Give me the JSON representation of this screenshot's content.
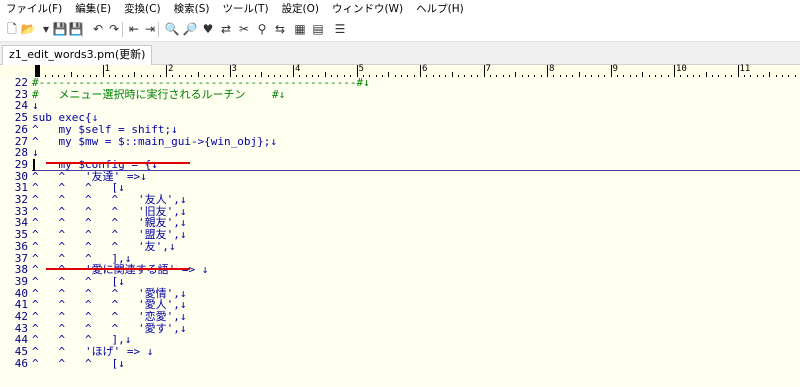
{
  "menu": [
    "ファイル(F)",
    "編集(E)",
    "変換(C)",
    "検索(S)",
    "ツール(T)",
    "設定(O)",
    "ウィンドウ(W)",
    "ヘルプ(H)"
  ],
  "toolbar_icons": [
    "new-file-icon",
    "open-file-icon",
    "open-dropdown-icon",
    "save-icon",
    "save-all-icon",
    "undo-icon",
    "redo-icon",
    "back-icon",
    "forward-icon",
    "find-icon",
    "find-next-icon",
    "find-prev-icon",
    "replace-icon",
    "grep-icon",
    "jump-icon",
    "compare-icon",
    "window-icon",
    "outline-icon",
    "settings-icon"
  ],
  "tab": {
    "label": "z1_edit_words3.pm(更新)"
  },
  "ruler": [
    "1",
    "2",
    "3",
    "4",
    "5",
    "6",
    "7",
    "8",
    "9",
    "10",
    "11"
  ],
  "lines": [
    {
      "num": "22",
      "text": "#------------------------------------------------#↓",
      "cls": "comment"
    },
    {
      "num": "23",
      "text": "#   メニュー選択時に実行されるルーチン    #↓",
      "cls": "comment"
    },
    {
      "num": "24",
      "text": "↓",
      "cls": ""
    },
    {
      "num": "25",
      "text": "sub exec{↓",
      "cls": ""
    },
    {
      "num": "26",
      "text": "^   my $self = shift;↓",
      "cls": ""
    },
    {
      "num": "27",
      "text": "^   my $mw = $::main_gui->{win_obj};↓",
      "cls": ""
    },
    {
      "num": "28",
      "text": "↓",
      "cls": ""
    },
    {
      "num": "29",
      "text": "    my $config = {↓",
      "cls": ""
    },
    {
      "num": "30",
      "text": "^   ^   '友達' =>↓",
      "cls": ""
    },
    {
      "num": "31",
      "text": "^   ^   ^   [↓",
      "cls": ""
    },
    {
      "num": "32",
      "text": "^   ^   ^   ^   '友人',↓",
      "cls": ""
    },
    {
      "num": "33",
      "text": "^   ^   ^   ^   '旧友',↓",
      "cls": ""
    },
    {
      "num": "34",
      "text": "^   ^   ^   ^   '親友',↓",
      "cls": ""
    },
    {
      "num": "35",
      "text": "^   ^   ^   ^   '盟友',↓",
      "cls": ""
    },
    {
      "num": "36",
      "text": "^   ^   ^   ^   '友',↓",
      "cls": ""
    },
    {
      "num": "37",
      "text": "^   ^   ^   ],↓",
      "cls": ""
    },
    {
      "num": "38",
      "text": "^   ^   '愛に関連する語' => ↓",
      "cls": ""
    },
    {
      "num": "39",
      "text": "^   ^   ^   [↓",
      "cls": ""
    },
    {
      "num": "40",
      "text": "^   ^   ^   ^   '愛情',↓",
      "cls": ""
    },
    {
      "num": "41",
      "text": "^   ^   ^   ^   '愛人',↓",
      "cls": ""
    },
    {
      "num": "42",
      "text": "^   ^   ^   ^   '恋愛',↓",
      "cls": ""
    },
    {
      "num": "43",
      "text": "^   ^   ^   ^   '愛す',↓",
      "cls": ""
    },
    {
      "num": "44",
      "text": "^   ^   ^   ],↓",
      "cls": ""
    },
    {
      "num": "45",
      "text": "^   ^   'ほげ' => ↓",
      "cls": ""
    },
    {
      "num": "46",
      "text": "^   ^   ^   [↓",
      "cls": ""
    }
  ],
  "colors": {
    "editor_bg": "#fffff0",
    "code": "#0000a0",
    "comment": "#008000",
    "line_numbers": "#000080",
    "annotation": "#e00000"
  }
}
